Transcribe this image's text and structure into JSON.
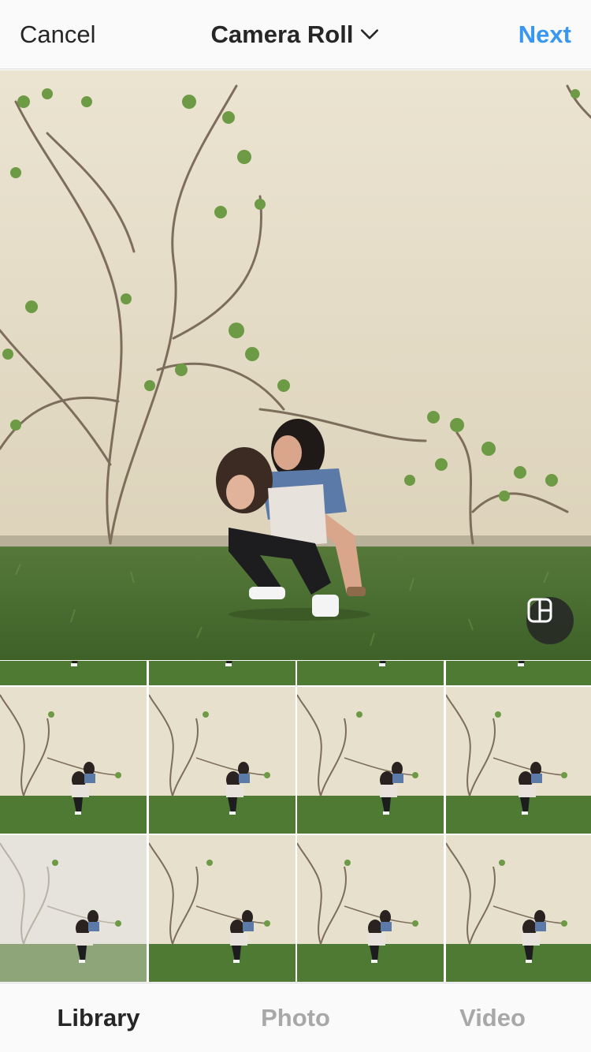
{
  "header": {
    "cancel_label": "Cancel",
    "title": "Camera Roll",
    "next_label": "Next",
    "accent_color": "#3897f0"
  },
  "preview": {
    "expand_icon": "layout-expand-icon"
  },
  "grid": {
    "rows": 3,
    "columns": 4,
    "items": [
      "photo",
      "photo",
      "photo",
      "photo",
      "photo",
      "photo",
      "photo",
      "photo",
      "photo",
      "photo",
      "photo",
      "photo"
    ]
  },
  "tabs": {
    "items": [
      {
        "label": "Library",
        "active": true
      },
      {
        "label": "Photo",
        "active": false
      },
      {
        "label": "Video",
        "active": false
      }
    ]
  }
}
